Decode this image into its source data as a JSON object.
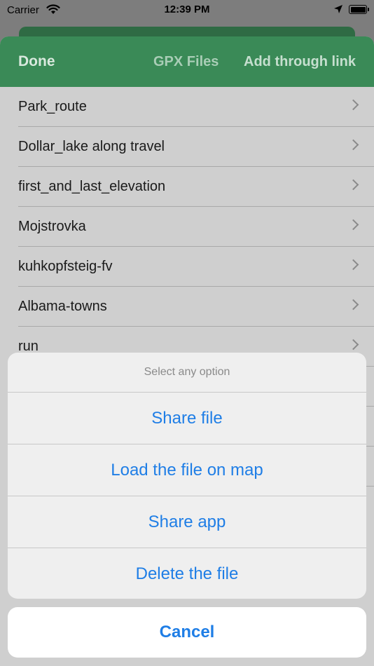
{
  "status_bar": {
    "carrier": "Carrier",
    "time": "12:39 PM"
  },
  "nav": {
    "done_label": "Done",
    "title": "GPX Files",
    "add_link_label": "Add through link"
  },
  "files": [
    "Park_route",
    "Dollar_lake along travel",
    "first_and_last_elevation",
    "Mojstrovka",
    "kuhkopfsteig-fv",
    "Albama-towns",
    "run"
  ],
  "action_sheet": {
    "header": "Select any option",
    "options": [
      "Share file",
      "Load the file on map",
      "Share app",
      "Delete the file"
    ],
    "cancel_label": "Cancel"
  },
  "colors": {
    "nav_green": "#3a8a57",
    "action_blue": "#1f7ee6"
  },
  "icons": {
    "wifi": "wifi-icon",
    "location": "location-arrow-icon",
    "battery": "battery-icon",
    "row_disclosure": "chevron-right-icon"
  }
}
